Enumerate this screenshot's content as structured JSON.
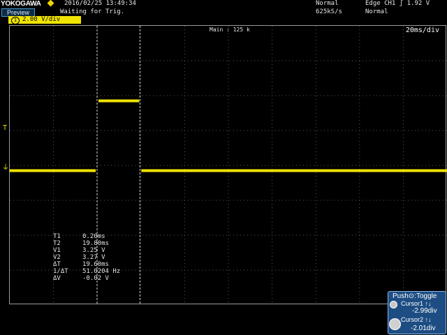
{
  "header": {
    "brand": "YOKOGAWA",
    "mode_badge": "Preview",
    "datetime": "2016/02/25 13:49:34",
    "status": "Waiting for Trig.",
    "acq_mode": "Normal",
    "sample_rate": "625kS/s",
    "trigger_source": "Edge CH1  ʃ 1.92 V",
    "trigger_mode": "Normal"
  },
  "channel": {
    "number": "1",
    "scale": "2.00 V/div",
    "color": "#f0e400"
  },
  "screen": {
    "main_rate": "Main : 125 k",
    "timebase": "20ms/div",
    "trigger_marker": "T",
    "ground_marker": "⏚",
    "waveform": {
      "low_level_div": -0.15,
      "high_level_div": 1.85,
      "pulse_start_ms": 0.2,
      "pulse_end_ms": 19.8
    }
  },
  "measurements": [
    {
      "label": "T1",
      "value": "0.20ms"
    },
    {
      "label": "T2",
      "value": "19.80ms"
    },
    {
      "label": "V1",
      "value": "3.25 V"
    },
    {
      "label": "V2",
      "value": "3.27 V"
    },
    {
      "label": "ΔT",
      "value": "19.60ms"
    },
    {
      "label": "1/ΔT",
      "value": "51.0204 Hz"
    },
    {
      "label": "ΔV",
      "value": "-0.02 V"
    }
  ],
  "cursor_panel": {
    "push_label": "Push⊙:Toggle",
    "cursor1_label": "Cursor1 ↑↓",
    "cursor1_value": "-2.99div",
    "cursor2_label": "Cursor2 ↑↓",
    "cursor2_value": "-2.01div"
  }
}
